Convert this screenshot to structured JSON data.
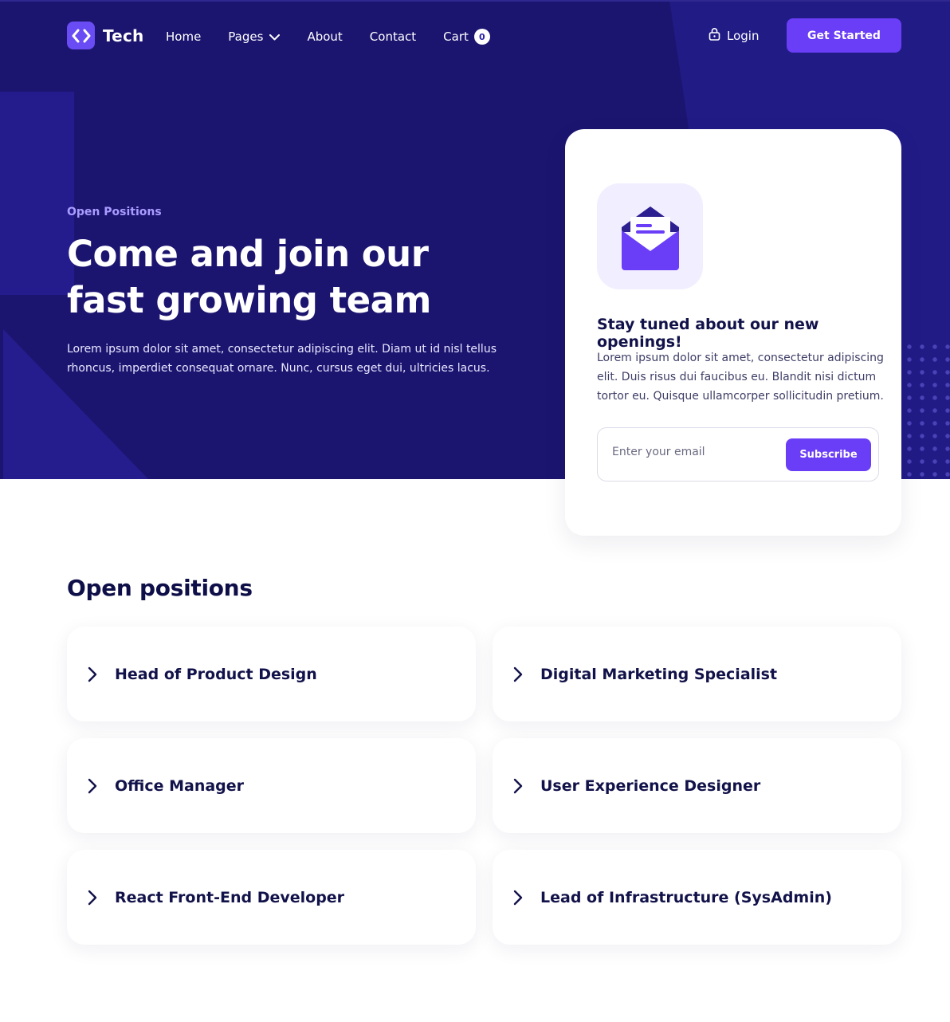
{
  "brand": {
    "name": "Tech"
  },
  "nav": {
    "items": [
      {
        "label": "Home"
      },
      {
        "label": "Pages"
      },
      {
        "label": "About"
      },
      {
        "label": "Contact"
      },
      {
        "label": "Cart"
      }
    ],
    "cart_count": "0",
    "login_label": "Login",
    "cta_label": "Get Started"
  },
  "hero": {
    "eyebrow": "Open Positions",
    "title": "Come and join our fast growing team",
    "description": "Lorem ipsum dolor sit amet, consectetur adipiscing elit. Diam ut id nisl tellus rhoncus, imperdiet consequat ornare. Nunc, cursus eget dui, ultricies lacus."
  },
  "subscribe": {
    "icon": "mail-open-icon",
    "title": "Stay tuned about our new openings!",
    "description": "Lorem ipsum dolor sit amet, consectetur adipiscing elit. Duis risus dui faucibus eu. Blandit nisi dictum tortor eu. Quisque ullamcorper sollicitudin pretium.",
    "email_placeholder": "Enter your email",
    "button_label": "Subscribe"
  },
  "positions": {
    "title": "Open positions",
    "items": [
      {
        "title": "Head of Product Design"
      },
      {
        "title": "Digital Marketing Specialist"
      },
      {
        "title": "Office Manager"
      },
      {
        "title": "User Experience Designer"
      },
      {
        "title": "React Front-End Developer"
      },
      {
        "title": "Lead of Infrastructure (SysAdmin)"
      }
    ]
  },
  "colors": {
    "hero_bg": "#1c1570",
    "accent": "#6a3df7",
    "heading": "#12124a"
  }
}
